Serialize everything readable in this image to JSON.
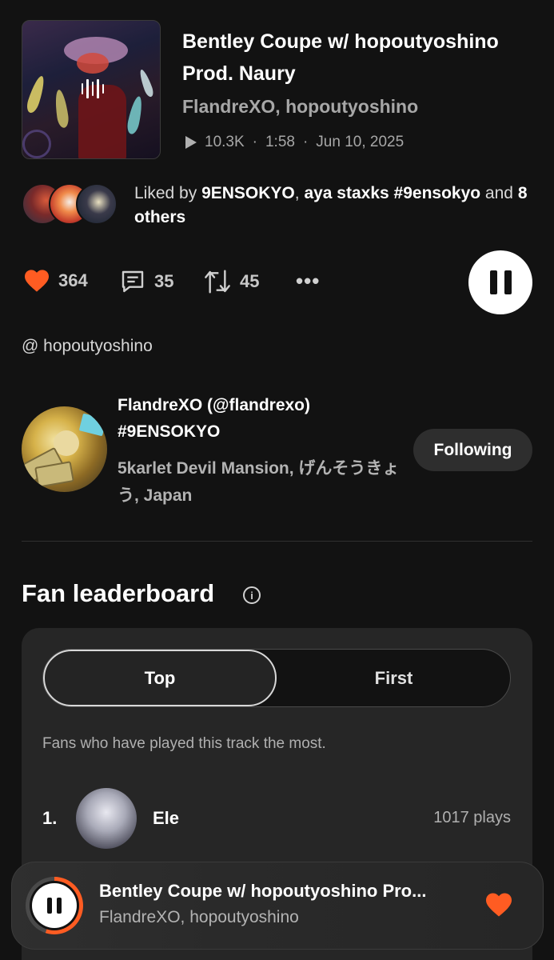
{
  "track": {
    "title": "Bentley Coupe w/ hopoutyoshino Prod. Naury",
    "artists": "FlandreXO, hopoutyoshino",
    "plays": "10.3K",
    "duration": "1:58",
    "date": "Jun 10, 2025"
  },
  "liked_by": {
    "prefix": "Liked by ",
    "user1": "9ENSOKYO",
    "sep": ", ",
    "user2": "aya staxks #9ensokyo",
    "and": " and ",
    "others": "8 others"
  },
  "actions": {
    "likes": "364",
    "comments": "35",
    "reposts": "45",
    "more": "•••"
  },
  "mention": "@ hopoutyoshino",
  "uploader": {
    "name": "FlandreXO (@flandrexo) #9ENSOKYO",
    "location": "5karlet Devil Mansion, げんそうきょう, Japan",
    "follow_label": "Following"
  },
  "leaderboard": {
    "title": "Fan leaderboard",
    "tabs": {
      "top": "Top",
      "first": "First"
    },
    "description": "Fans who have played this track the most.",
    "entries": [
      {
        "rank": "1.",
        "name": "Ele",
        "plays": "1017 plays"
      }
    ]
  },
  "mini_player": {
    "title": "Bentley Coupe w/ hopoutyoshino Pro...",
    "artists": "FlandreXO, hopoutyoshino",
    "progress": 0.55
  },
  "colors": {
    "accent": "#ff5c22",
    "background": "#121212",
    "card": "#262626"
  }
}
